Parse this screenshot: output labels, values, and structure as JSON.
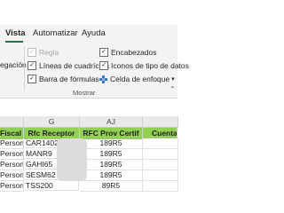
{
  "ribbon_tabs": [
    {
      "label": "Vista",
      "active": true
    },
    {
      "label": "Automatizar",
      "active": false
    },
    {
      "label": "Ayuda",
      "active": false
    }
  ],
  "ribbon": {
    "partial_left_label": "egación",
    "options": [
      {
        "label": "Regla",
        "checked": true,
        "disabled": true
      },
      {
        "label": "Líneas de cuadrícula",
        "checked": true,
        "disabled": false
      },
      {
        "label": "Barra de fórmulas",
        "checked": true,
        "disabled": false
      },
      {
        "label": "Encabezados",
        "checked": true,
        "disabled": false
      },
      {
        "label": "Iconos de tipo de datos",
        "checked": true,
        "disabled": false
      },
      {
        "label": "Celda de enfoque",
        "has_dropdown": true
      }
    ],
    "group_label": "Mostrar",
    "accent_color": "#217346"
  },
  "sheet": {
    "column_letters": [
      "",
      "G",
      "AJ",
      ""
    ],
    "headers": [
      "Fiscal",
      "Rfc Receptor",
      "RFC Prov Certif",
      "Cuenta"
    ],
    "header_color": "#92d050",
    "rows": [
      [
        "Persona",
        "CAR1402",
        "189R5",
        ""
      ],
      [
        "Persona",
        "MANR9",
        "189R5",
        ""
      ],
      [
        "Persona",
        "GAHI65",
        "189R5",
        ""
      ],
      [
        "Persona",
        "SESM62",
        "189R5",
        ""
      ],
      [
        "Persona",
        "TSS200",
        "89R5",
        ""
      ]
    ]
  }
}
